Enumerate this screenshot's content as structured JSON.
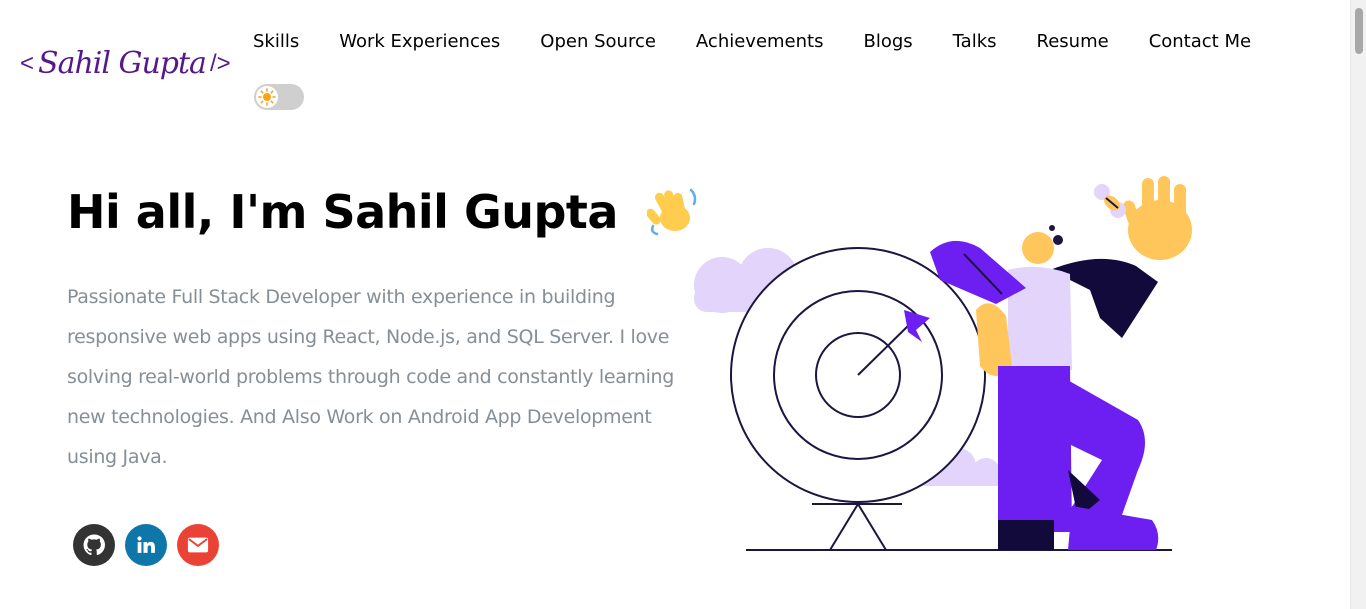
{
  "logo": {
    "open_bracket": "<",
    "signature": "Sahil Gupta",
    "close_bracket": "/>",
    "color": "#55198b"
  },
  "nav": {
    "items": [
      {
        "label": "Skills"
      },
      {
        "label": "Work Experiences"
      },
      {
        "label": "Open Source"
      },
      {
        "label": "Achievements"
      },
      {
        "label": "Blogs"
      },
      {
        "label": "Talks"
      },
      {
        "label": "Resume"
      },
      {
        "label": "Contact Me"
      }
    ]
  },
  "theme_toggle": {
    "mode": "light",
    "icon": "sun-icon"
  },
  "hero": {
    "greeting": "Hi all, I'm Sahil Gupta",
    "wave_icon": "waving-hand-icon",
    "subtitle": "Passionate Full Stack Developer with experience in building responsive web apps using React, Node.js, and SQL Server. I love solving real-world problems through code and constantly learning new technologies. And Also Work on Android App Development using Java."
  },
  "socials": [
    {
      "name": "github-icon",
      "color": "#333333"
    },
    {
      "name": "linkedin-icon",
      "color": "#0e76a8"
    },
    {
      "name": "mail-icon",
      "color": "#ea4335"
    }
  ],
  "colors": {
    "accent": "#6c1ff0",
    "text_muted": "#868e96",
    "cloud": "#e2d4fb",
    "skin": "#ffc65c"
  }
}
